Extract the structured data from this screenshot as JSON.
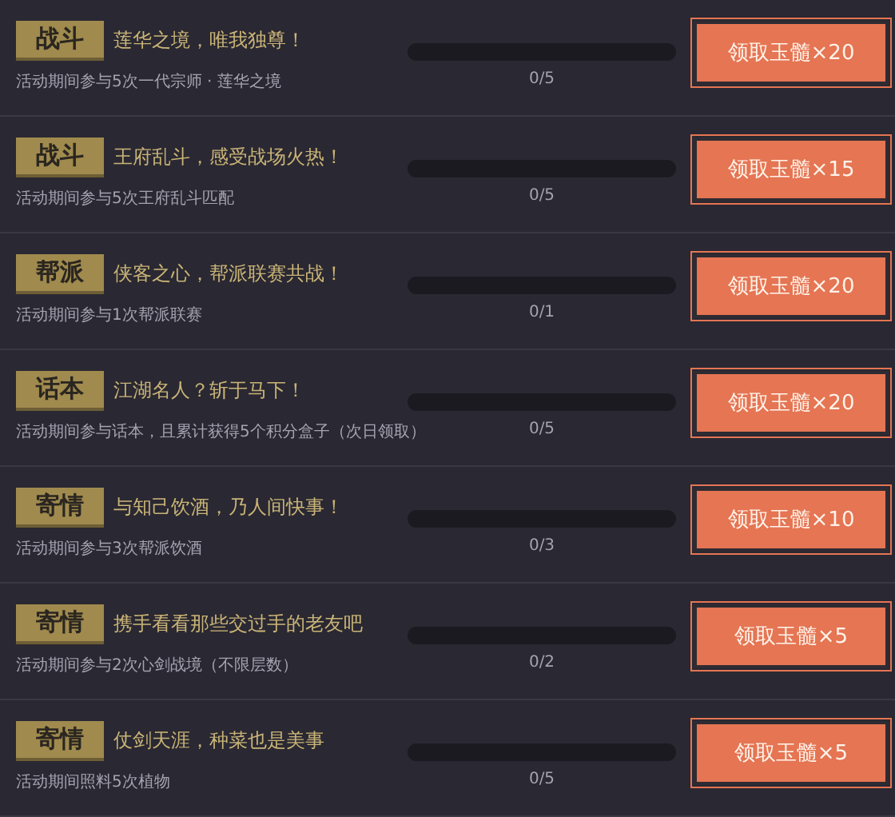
{
  "tasks": [
    {
      "tag": "战斗",
      "title": "莲华之境，唯我独尊！",
      "description": "活动期间参与5次一代宗师 · 莲华之境",
      "level": 0,
      "progress": "0/5",
      "button": "领取玉髓×20"
    },
    {
      "tag": "战斗",
      "title": "王府乱斗，感受战场火热！",
      "description": "活动期间参与5次王府乱斗匹配",
      "level": 0,
      "progress": "0/5",
      "button": "领取玉髓×15"
    },
    {
      "tag": "帮派",
      "title": "侠客之心，帮派联赛共战！",
      "description": "活动期间参与1次帮派联赛",
      "level": 0,
      "progress": "0/1",
      "button": "领取玉髓×20"
    },
    {
      "tag": "话本",
      "title": "江湖名人？斩于马下！",
      "description": "活动期间参与话本，且累计获得5个积分盒子（次日领取）",
      "level": 0,
      "progress": "0/5",
      "button": "领取玉髓×20"
    },
    {
      "tag": "寄情",
      "title": "与知己饮酒，乃人间快事！",
      "description": "活动期间参与3次帮派饮酒",
      "level": 0,
      "progress": "0/3",
      "button": "领取玉髓×10"
    },
    {
      "tag": "寄情",
      "title": "携手看看那些交过手的老友吧",
      "description": "活动期间参与2次心剑战境（不限层数）",
      "level": 0,
      "progress": "0/2",
      "button": "领取玉髓×5"
    },
    {
      "tag": "寄情",
      "title": "仗剑天涯，种菜也是美事",
      "description": "活动期间照料5次植物",
      "level": 0,
      "progress": "0/5",
      "button": "领取玉髓×5"
    }
  ]
}
